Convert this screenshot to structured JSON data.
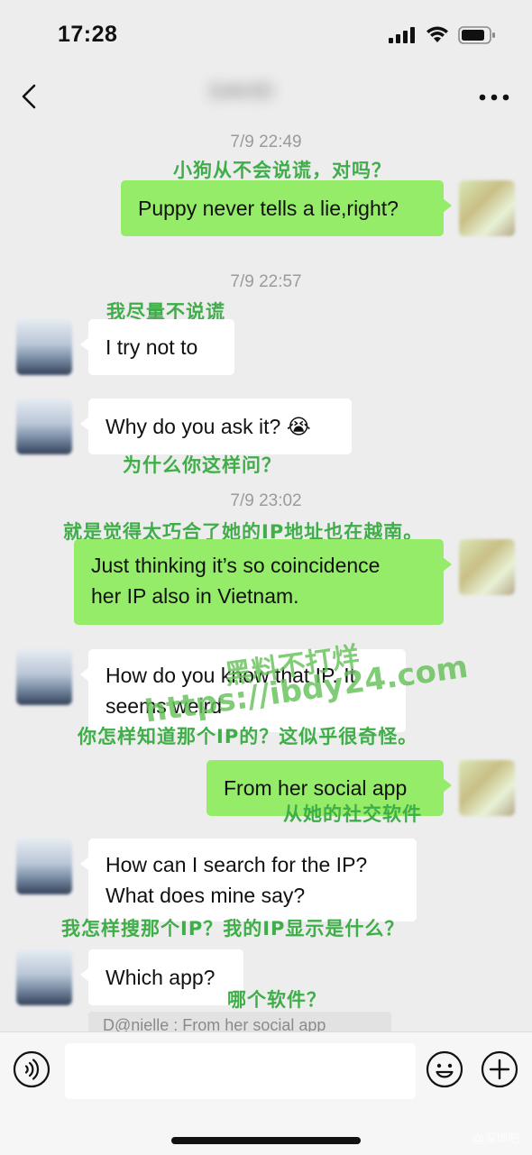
{
  "status_bar": {
    "time": "17:28"
  },
  "header": {
    "title": "DAVID"
  },
  "messages": [
    {
      "timestamp": "7/9 22:49"
    },
    {
      "text": "Puppy never tells a lie,right?",
      "caption": "小狗从不会说谎，对吗？"
    },
    {
      "timestamp": "7/9 22:57"
    },
    {
      "text": "I try not to",
      "caption": "我尽量不说谎"
    },
    {
      "text": "Why do you ask it? 😭",
      "caption": "为什么你这样问？"
    },
    {
      "timestamp": "7/9 23:02"
    },
    {
      "text_line1": "Just thinking it’s so coincidence",
      "text_line2": "her IP also in Vietnam.",
      "caption": "就是觉得太巧合了她的IP地址也在越南。"
    },
    {
      "text_line1": "How do you know that IP. It",
      "text_line2": "seems weird",
      "caption": "你怎样知道那个IP的？这似乎很奇怪。"
    },
    {
      "text": "From her social app",
      "caption": "从她的社交软件"
    },
    {
      "text_line1": "How can I search for the IP?",
      "text_line2": "What does mine say?",
      "caption": "我怎样搜那个IP？我的IP显示是什么？"
    },
    {
      "text": "Which app?",
      "caption": "哪个软件？"
    }
  ],
  "quote_ref": "D@nielle : From her social app",
  "watermark": {
    "line1": "黑料不打烊",
    "line2": "https://ibdy24.com"
  },
  "corner_mark": "@深圳吧",
  "icons": {
    "back": "chevron-left-icon",
    "more": "more-dots-icon",
    "voice": "voice-icon",
    "emoji": "emoji-icon",
    "plus": "plus-icon",
    "signal": "signal-icon",
    "wifi": "wifi-icon",
    "battery": "battery-icon"
  },
  "colors": {
    "sent_bubble": "#95ec69",
    "received_bubble": "#ffffff",
    "caption": "#3fae49",
    "background": "#ededed"
  }
}
